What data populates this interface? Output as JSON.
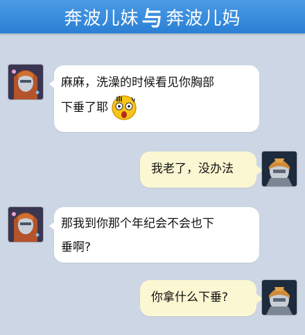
{
  "header": {
    "title_left": "奔波儿妹",
    "separator": "与",
    "title_right": "奔波儿妈"
  },
  "messages": [
    {
      "side": "left",
      "sender": "奔波儿妹",
      "text_line1": "麻麻，洗澡的时候看见你胸部",
      "text_line2": "下垂了耶",
      "emoji": "shocked-face-emoji"
    },
    {
      "side": "right",
      "sender": "奔波儿妈",
      "text": "我老了，没办法"
    },
    {
      "side": "left",
      "sender": "奔波儿妹",
      "text_line1": "那我到你那个年纪会不会也下",
      "text_line2": "垂啊?"
    },
    {
      "side": "right",
      "sender": "奔波儿妈",
      "text": "你拿什么下垂?"
    }
  ],
  "colors": {
    "background": "#cdd6e4",
    "header": "#3a8fe0",
    "left_bubble": "#ffffff",
    "right_bubble": "#fbf7d2"
  }
}
